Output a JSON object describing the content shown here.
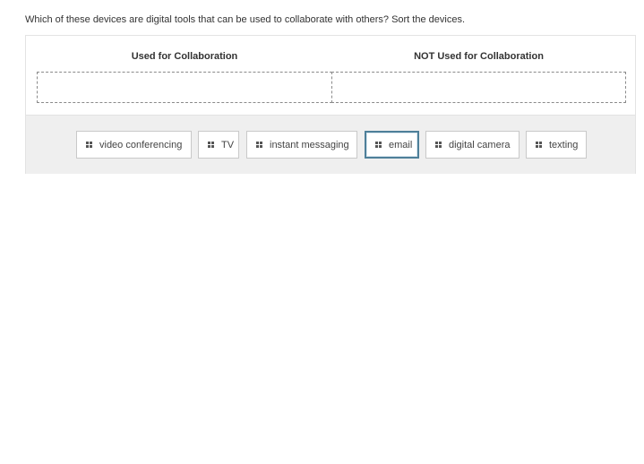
{
  "question": {
    "prompt": "Which of these devices are digital tools that can be used to collaborate with others? Sort the devices."
  },
  "columns": [
    {
      "header": "Used for Collaboration",
      "items": []
    },
    {
      "header": "NOT Used for Collaboration",
      "items": []
    }
  ],
  "tray": {
    "chips": [
      {
        "label": "video conferencing",
        "icon": "drag-handle-icon",
        "selected": false
      },
      {
        "label": "TV",
        "icon": "drag-handle-icon",
        "selected": false
      },
      {
        "label": "instant messaging",
        "icon": "drag-handle-icon",
        "selected": false
      },
      {
        "label": "email",
        "icon": "drag-handle-icon",
        "selected": true
      },
      {
        "label": "digital camera",
        "icon": "drag-handle-icon",
        "selected": false
      },
      {
        "label": "texting",
        "icon": "drag-handle-icon",
        "selected": false
      }
    ]
  },
  "colors": {
    "selected_border": "#4e7f99",
    "tray_background": "#efefef",
    "drop_zone_border": "#8a8a8a"
  }
}
